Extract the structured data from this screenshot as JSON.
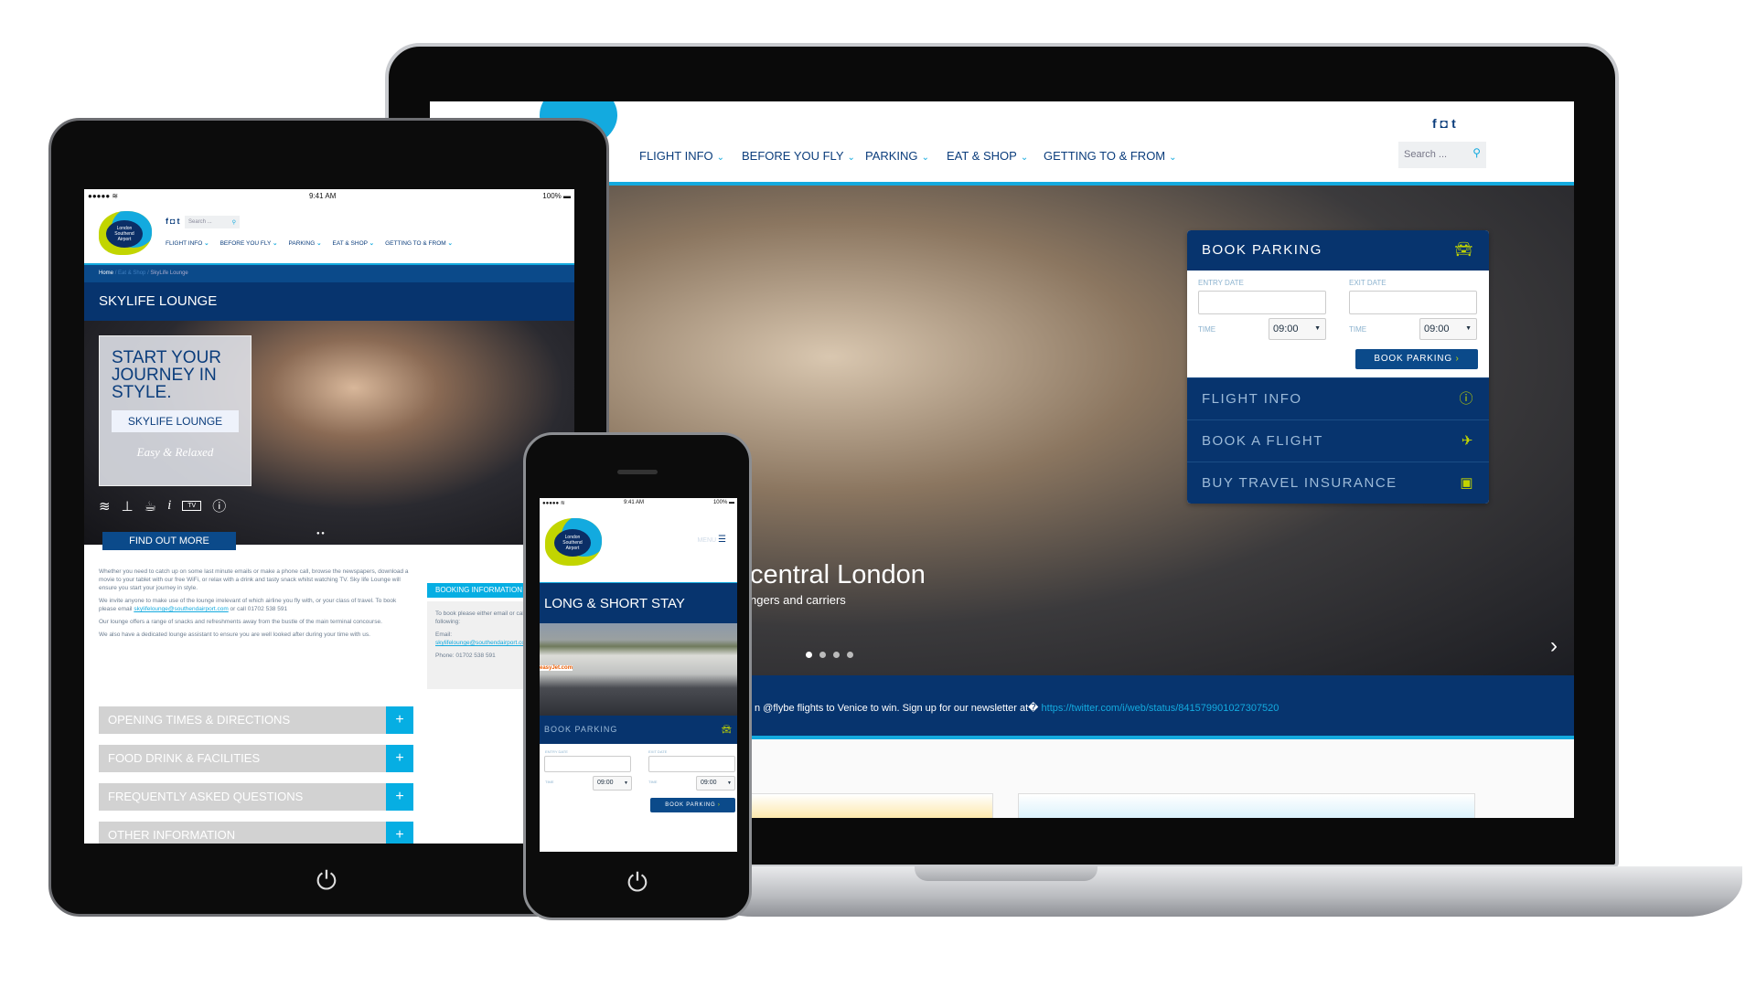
{
  "laptop": {
    "nav": [
      "FLIGHT INFO",
      "BEFORE YOU FLY",
      "PARKING",
      "EAT & SHOP",
      "GETTING TO & FROM"
    ],
    "search_placeholder": "Search ...",
    "social": [
      "facebook-icon",
      "instagram-icon",
      "twitter-icon"
    ],
    "hero_title": "central London",
    "hero_subtitle": "ngers and carriers",
    "slides": 4,
    "active_slide": 1,
    "book_parking": {
      "title": "BOOK PARKING",
      "entry_label": "ENTRY DATE",
      "exit_label": "EXIT DATE",
      "time_label": "TIME",
      "entry_time": "09:00",
      "exit_time": "09:00",
      "button": "BOOK PARKING"
    },
    "menu": [
      {
        "label": "FLIGHT INFO",
        "icon": "info-icon"
      },
      {
        "label": "BOOK A FLIGHT",
        "icon": "plane-icon"
      },
      {
        "label": "BUY TRAVEL INSURANCE",
        "icon": "briefcase-icon"
      }
    ],
    "tweet_text": "n @flybe flights to Venice to win. Sign up for our newsletter at�",
    "tweet_link": "https://twitter.com/i/web/status/841579901027307520"
  },
  "tablet": {
    "status": {
      "time": "9:41 AM",
      "battery": "100%"
    },
    "logo": [
      "London",
      "Southend",
      "Airport"
    ],
    "search_placeholder": "Search ...",
    "nav": [
      "FLIGHT INFO",
      "BEFORE YOU FLY",
      "PARKING",
      "EAT & SHOP",
      "GETTING TO & FROM"
    ],
    "breadcrumb": [
      "Home",
      "Eat & Shop",
      "SkyLife Lounge"
    ],
    "title": "SKYLIFE LOUNGE",
    "hero_heading": "START YOUR JOURNEY IN STYLE.",
    "hero_button": "SKYLIFE LOUNGE",
    "hero_tagline": "Easy & Relaxed",
    "tv": "TV",
    "find_out_more": "FIND OUT MORE",
    "body": {
      "p1": "Whether you need to catch up on some last minute emails or make a phone call, browse the newspapers, download a movie to your tablet with our free WiFi, or relax with a drink and tasty snack whilst watching TV. Sky life Lounge will ensure you start your journey in style.",
      "p2a": "We invite anyone to make use of  the lounge irrelevant of which airline you fly with, or your class of travel. To book please email ",
      "email": "skylifelounge@southendairport.com",
      "p2b": " or call 01702 538 591",
      "p3": "Our lounge offers a range of snacks and refreshments away from the bustle of the main terminal concourse.",
      "p4": "We also have a dedicated lounge assistant to ensure you are well looked after during your time with us."
    },
    "booking": {
      "title": "BOOKING INFORMATION",
      "text": "To book please either email or call on the following:",
      "email_label": "Email:",
      "email": "skylifelounge@southendairport.com",
      "phone": "Phone: 01702 538 591"
    },
    "accordion": [
      "OPENING TIMES & DIRECTIONS",
      "FOOD DRINK & FACILITIES",
      "FREQUENTLY ASKED QUESTIONS",
      "OTHER INFORMATION"
    ]
  },
  "phone": {
    "status": {
      "time": "9:41 AM",
      "battery": "100%"
    },
    "logo": [
      "London",
      "Southend",
      "Airport"
    ],
    "menu": "MENU",
    "title": "LONG & SHORT STAY",
    "image_text": "easyJet.com",
    "book_parking": {
      "title": "BOOK PARKING",
      "entry_label": "ENTRY DATE",
      "exit_label": "EXIT DATE",
      "time_label": "TIME",
      "entry_time": "09:00",
      "exit_time": "09:00",
      "button": "BOOK PARKING"
    }
  },
  "colors": {
    "navy": "#07346e",
    "cyan": "#13aadf",
    "lime": "#c2d500"
  }
}
